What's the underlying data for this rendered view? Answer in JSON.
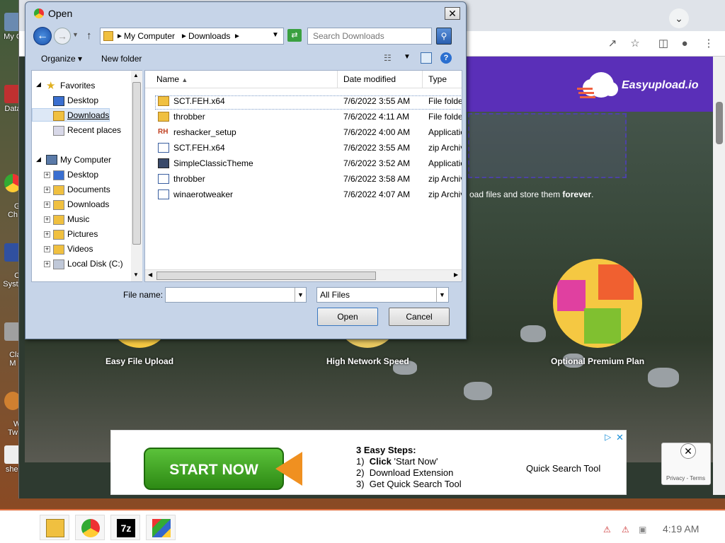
{
  "desktop": {
    "icons": [
      {
        "label": "My C"
      },
      {
        "label": "Data"
      },
      {
        "label": "G\nCh"
      },
      {
        "label": "C\nSyste"
      },
      {
        "label": "Clas\nM"
      },
      {
        "label": "W\nTw"
      },
      {
        "label": "shel"
      }
    ]
  },
  "browser": {
    "brand_name": "Easyupload.io",
    "tagline_prefix": "oad files and store them ",
    "tagline_bold": "forever",
    "tagline_suffix": ".",
    "features": [
      {
        "label": "Easy File Upload"
      },
      {
        "label": "High Network Speed"
      },
      {
        "label": "Optional Premium Plan"
      }
    ],
    "ad": {
      "start_label": "START NOW",
      "steps_title": "3 Easy Steps:",
      "step1_num": "1)",
      "step1_bold": "Click",
      "step1_rest": " 'Start Now'",
      "step2": "2)  Download Extension",
      "step3": "3)  Get Quick Search Tool",
      "quick_search": "Quick Search Tool"
    },
    "recaptcha_terms": "Privacy - Terms"
  },
  "dialog": {
    "title": "Open",
    "address": {
      "crumbs": [
        "My Computer",
        "Downloads"
      ]
    },
    "search_placeholder": "Search Downloads",
    "toolbar": {
      "organize": "Organize",
      "new_folder": "New folder"
    },
    "nav": {
      "favorites": "Favorites",
      "fav_items": [
        "Desktop",
        "Downloads",
        "Recent places"
      ],
      "computer": "My Computer",
      "computer_items": [
        "Desktop",
        "Documents",
        "Downloads",
        "Music",
        "Pictures",
        "Videos",
        "Local Disk (C:)"
      ]
    },
    "columns": {
      "name": "Name",
      "date": "Date modified",
      "type": "Type"
    },
    "files": [
      {
        "name": "SCT.FEH.x64",
        "date": "7/6/2022 3:55 AM",
        "type": "File folder",
        "icon": "folder-icon"
      },
      {
        "name": "throbber",
        "date": "7/6/2022 4:11 AM",
        "type": "File folder",
        "icon": "folder-icon"
      },
      {
        "name": "reshacker_setup",
        "date": "7/6/2022 4:00 AM",
        "type": "Application",
        "icon": "reshacker-icon"
      },
      {
        "name": "SCT.FEH.x64",
        "date": "7/6/2022 3:55 AM",
        "type": "zip Archive",
        "icon": "zip-icon"
      },
      {
        "name": "SimpleClassicTheme",
        "date": "7/6/2022 3:52 AM",
        "type": "Application",
        "icon": "app-icon"
      },
      {
        "name": "throbber",
        "date": "7/6/2022 3:58 AM",
        "type": "zip Archive",
        "icon": "zip-icon"
      },
      {
        "name": "winaerotweaker",
        "date": "7/6/2022 4:07 AM",
        "type": "zip Archive",
        "icon": "zip-icon"
      }
    ],
    "file_name_label": "File name:",
    "file_name_value": "",
    "filter_value": "All Files",
    "open_label": "Open",
    "cancel_label": "Cancel"
  },
  "taskbar": {
    "time": "4:19 AM"
  }
}
